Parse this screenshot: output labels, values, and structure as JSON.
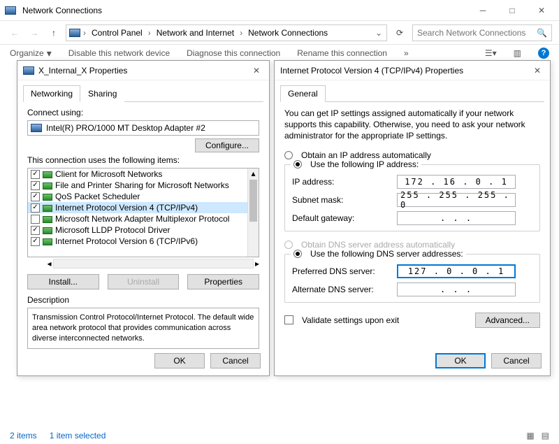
{
  "window": {
    "title": "Network Connections"
  },
  "nav": {
    "breadcrumb": [
      "Control Panel",
      "Network and Internet",
      "Network Connections"
    ],
    "search_placeholder": "Search Network Connections"
  },
  "cmdbar": {
    "organize": "Organize",
    "disable": "Disable this network device",
    "diagnose": "Diagnose this connection",
    "rename": "Rename this connection"
  },
  "status": {
    "count": "2 items",
    "selected": "1 item selected"
  },
  "adapter_dialog": {
    "title": "X_Internal_X Properties",
    "tabs": [
      "Networking",
      "Sharing"
    ],
    "connect_using": "Connect using:",
    "adapter": "Intel(R) PRO/1000 MT Desktop Adapter #2",
    "configure": "Configure...",
    "items_label": "This connection uses the following items:",
    "items": [
      {
        "checked": true,
        "label": "Client for Microsoft Networks"
      },
      {
        "checked": true,
        "label": "File and Printer Sharing for Microsoft Networks"
      },
      {
        "checked": true,
        "label": "QoS Packet Scheduler"
      },
      {
        "checked": true,
        "label": "Internet Protocol Version 4 (TCP/IPv4)",
        "selected": true
      },
      {
        "checked": false,
        "label": "Microsoft Network Adapter Multiplexor Protocol"
      },
      {
        "checked": true,
        "label": "Microsoft LLDP Protocol Driver"
      },
      {
        "checked": true,
        "label": "Internet Protocol Version 6 (TCP/IPv6)"
      }
    ],
    "install": "Install...",
    "uninstall": "Uninstall",
    "properties": "Properties",
    "description_label": "Description",
    "description": "Transmission Control Protocol/Internet Protocol. The default wide area network protocol that provides communication across diverse interconnected networks.",
    "ok": "OK",
    "cancel": "Cancel"
  },
  "ipv4_dialog": {
    "title": "Internet Protocol Version 4 (TCP/IPv4) Properties",
    "tab": "General",
    "intro": "You can get IP settings assigned automatically if your network supports this capability. Otherwise, you need to ask your network administrator for the appropriate IP settings.",
    "obtain_ip": "Obtain an IP address automatically",
    "use_ip": "Use the following IP address:",
    "ip_label": "IP address:",
    "ip_value": "172 . 16 .  0  .  1",
    "subnet_label": "Subnet mask:",
    "subnet_value": "255 . 255 . 255 .  0",
    "gateway_label": "Default gateway:",
    "gateway_value": ".       .       .",
    "obtain_dns": "Obtain DNS server address automatically",
    "use_dns": "Use the following DNS server addresses:",
    "pref_dns_label": "Preferred DNS server:",
    "pref_dns_value": "127 .  0  .  0  .  1",
    "alt_dns_label": "Alternate DNS server:",
    "alt_dns_value": ".       .       .",
    "validate": "Validate settings upon exit",
    "advanced": "Advanced...",
    "ok": "OK",
    "cancel": "Cancel"
  }
}
